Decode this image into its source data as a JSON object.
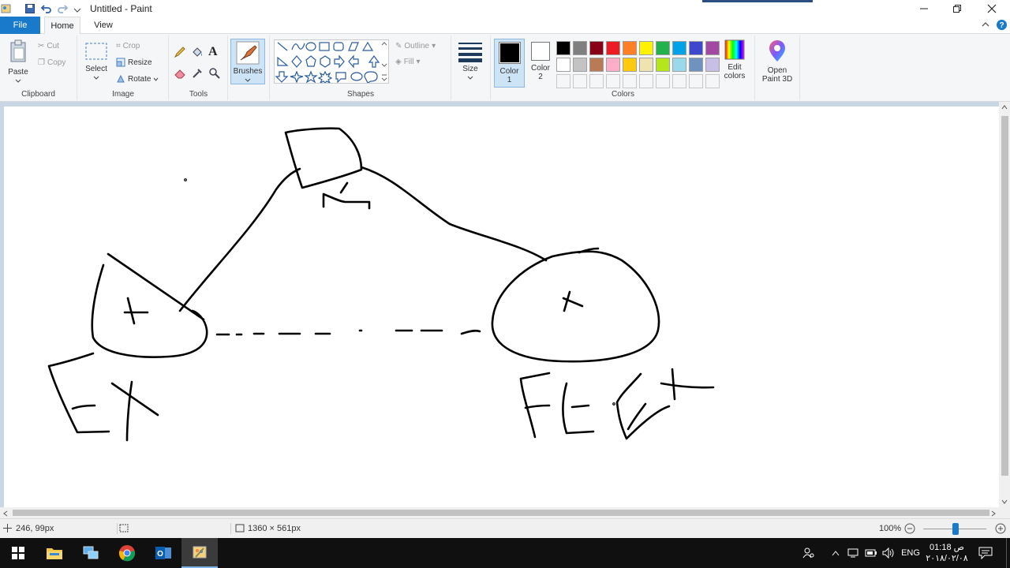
{
  "window": {
    "title": "Untitled - Paint"
  },
  "tabs": {
    "file": "File",
    "home": "Home",
    "view": "View"
  },
  "ribbon": {
    "clipboard": {
      "label": "Clipboard",
      "paste": "Paste",
      "cut": "Cut",
      "copy": "Copy"
    },
    "image": {
      "label": "Image",
      "select": "Select",
      "crop": "Crop",
      "resize": "Resize",
      "rotate": "Rotate"
    },
    "tools": {
      "label": "Tools"
    },
    "brushes": {
      "label": "Brushes"
    },
    "shapes": {
      "label": "Shapes",
      "outline": "Outline",
      "fill": "Fill"
    },
    "size": {
      "label": "Size"
    },
    "colors": {
      "label": "Colors",
      "color1": "Color",
      "color1_num": "1",
      "color2": "Color",
      "color2_num": "2",
      "edit": "Edit",
      "edit2": "colors",
      "palette_row1": [
        "#000000",
        "#7f7f7f",
        "#880015",
        "#ed1c24",
        "#ff7f27",
        "#fff200",
        "#22b14c",
        "#00a2e8",
        "#3f48cc",
        "#a349a4"
      ],
      "palette_row2": [
        "#ffffff",
        "#c3c3c3",
        "#b97a57",
        "#ffaec9",
        "#ffc90e",
        "#efe4b0",
        "#b5e61d",
        "#99d9ea",
        "#7092be",
        "#c8bfe7"
      ]
    },
    "paint3d": {
      "line1": "Open",
      "line2": "Paint 3D"
    }
  },
  "statusbar": {
    "cursor": "246, 99px",
    "canvas_size": "1360 × 561px",
    "zoom": "100%"
  },
  "taskbar": {
    "lang": "ENG",
    "time": "01:18 ص",
    "date": "٢٠١٨/٠٢/٠٨"
  },
  "colors": {
    "accent": "#1979ca",
    "workspace": "#c9d6e5",
    "taskbar": "#101010"
  }
}
